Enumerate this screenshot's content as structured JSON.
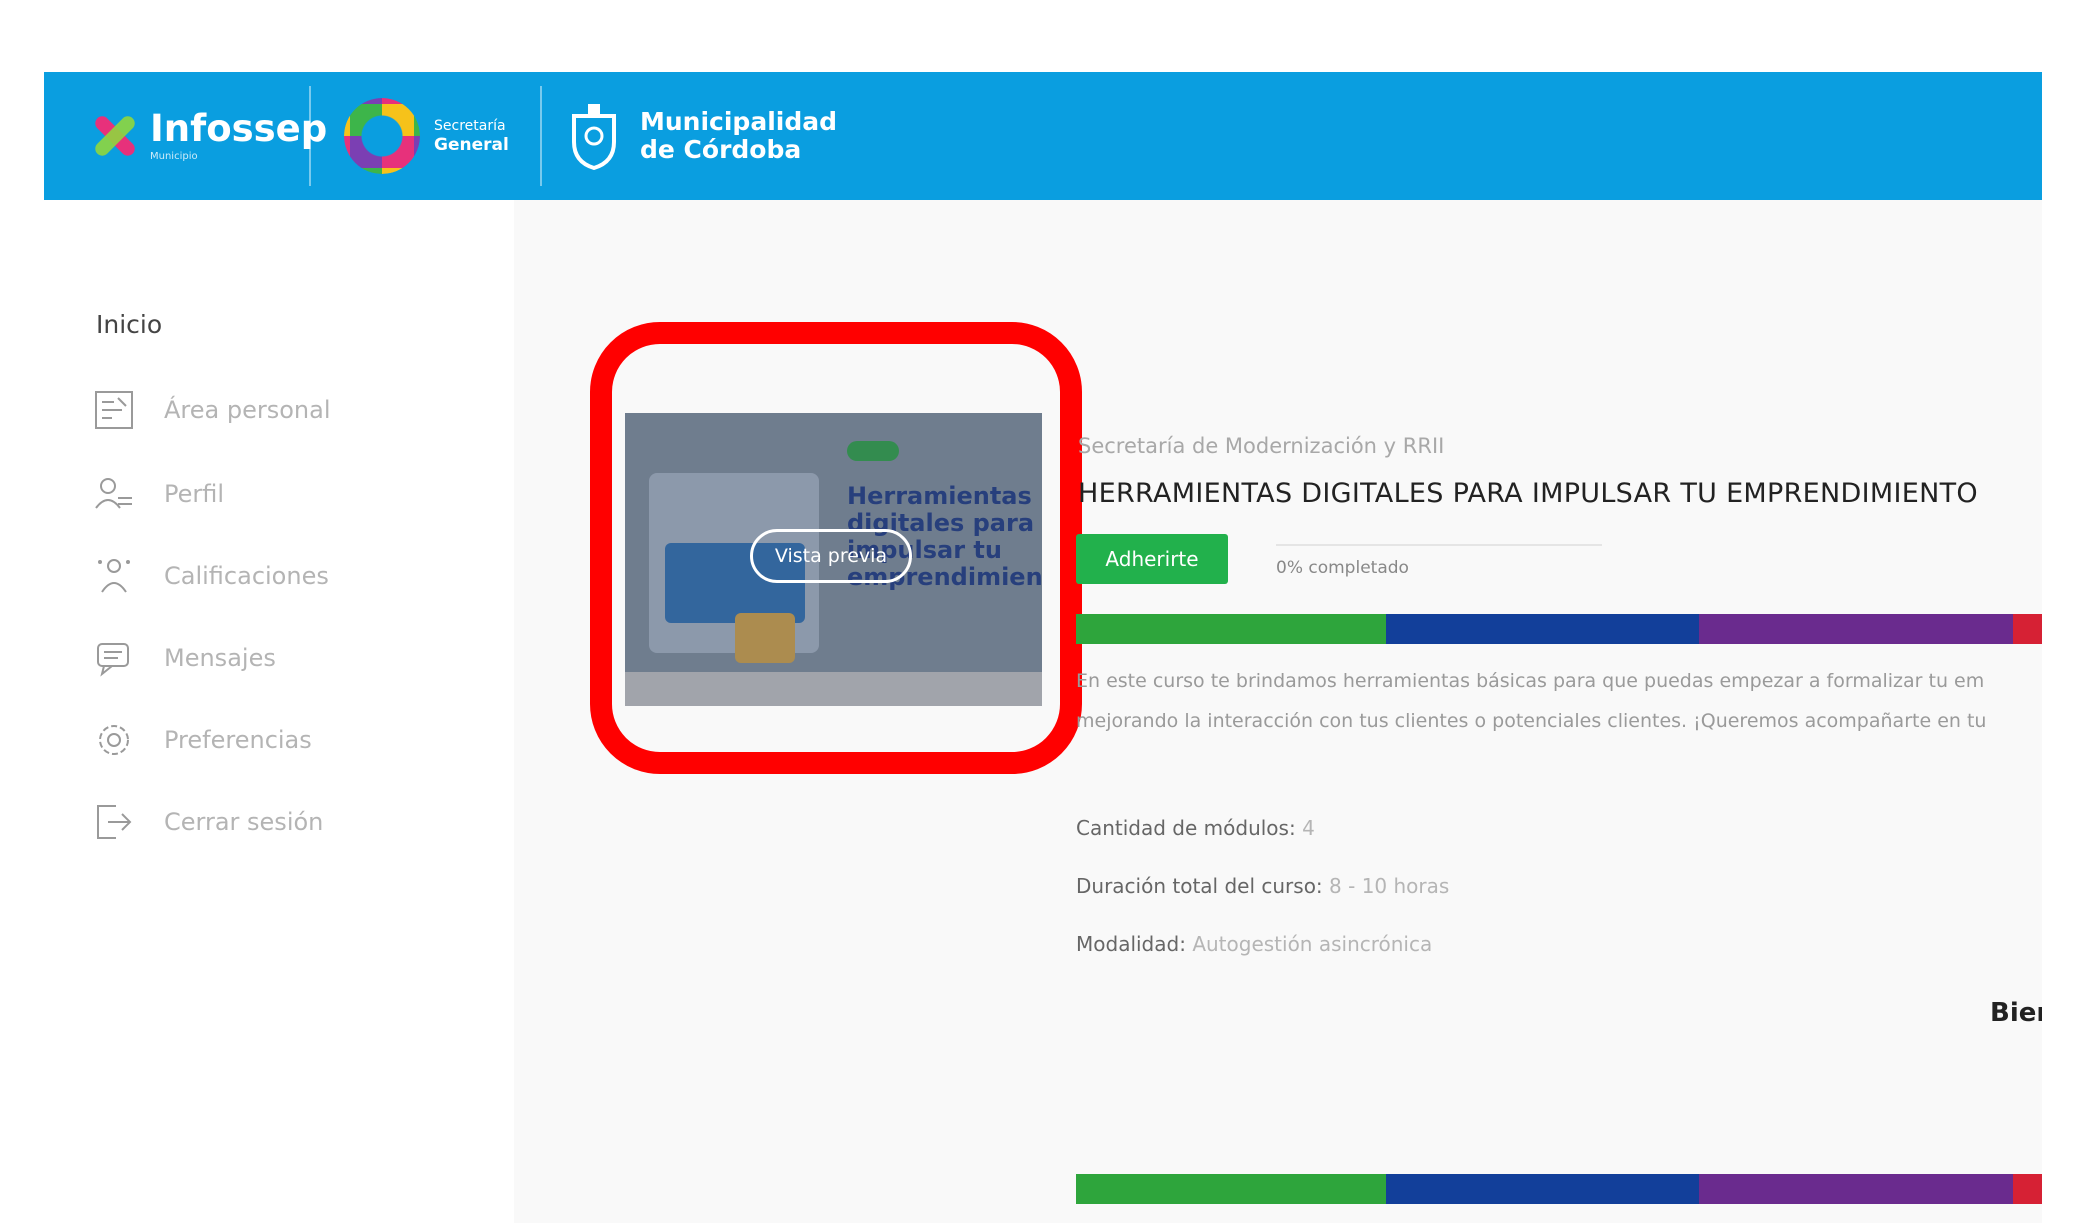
{
  "header": {
    "infossep": {
      "name": "Infossep",
      "subtitle": "Municipio"
    },
    "secretaria": {
      "line1": "Secretaría",
      "line2": "General"
    },
    "municipalidad": {
      "line1": "Municipalidad",
      "line2": "de Córdoba"
    },
    "background_color": "#0a9ee0"
  },
  "sidebar": {
    "title": "Inicio",
    "items": [
      {
        "label": "Área personal",
        "icon": "personal-area-icon"
      },
      {
        "label": "Perfil",
        "icon": "profile-icon"
      },
      {
        "label": "Calificaciones",
        "icon": "grades-icon"
      },
      {
        "label": "Mensajes",
        "icon": "messages-icon"
      },
      {
        "label": "Preferencias",
        "icon": "preferences-icon"
      },
      {
        "label": "Cerrar sesión",
        "icon": "logout-icon"
      }
    ]
  },
  "course": {
    "organization": "Secretaría de Modernización y RRII",
    "title": "HERRAMIENTAS DIGITALES PARA IMPULSAR TU EMPRENDIMIENTO",
    "enroll_label": "Adherirte",
    "progress_text": "0% completado",
    "progress": 0,
    "preview_label": "Vista previa",
    "thumbnail": {
      "title": "Herramientas digitales para impulsar tu emprendimiento"
    },
    "description_line1": "En este curso te brindamos herramientas básicas para que puedas empezar a formalizar tu em",
    "description_line2": "mejorando la interacción con tus clientes o potenciales clientes. ¡Queremos acompañarte en tu",
    "details": [
      {
        "label": "Cantidad de módulos:",
        "value": "4"
      },
      {
        "label": "Duración total del curso:",
        "value": "8 - 10 horas"
      },
      {
        "label": "Modalidad:",
        "value": "Autogestión asincrónica"
      }
    ],
    "welcome": "Bienv"
  },
  "colors": {
    "stripe": [
      "#2ea53c",
      "#123f9a",
      "#6a2b8e",
      "#d62134"
    ],
    "highlight": "#ff0000",
    "enroll": "#22b14c"
  }
}
